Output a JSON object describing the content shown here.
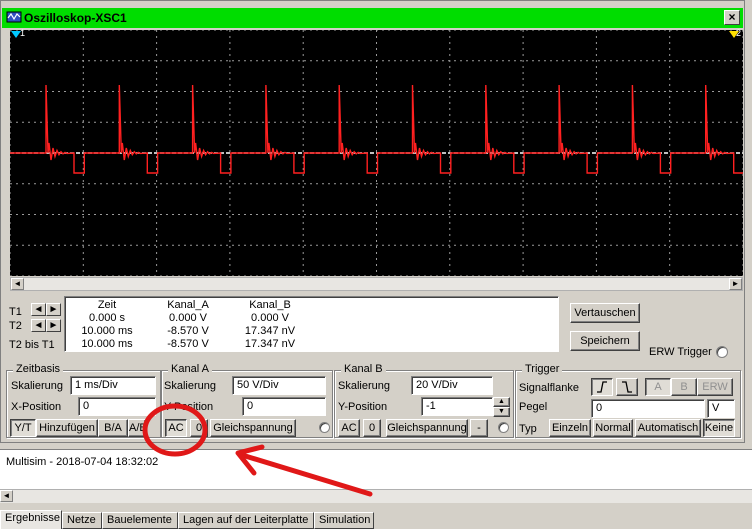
{
  "window": {
    "title": "Oszilloskop-XSC1",
    "close_label": "×"
  },
  "scope": {
    "cursor_1_label": "1",
    "cursor_2_label": "2"
  },
  "cursor_panel": {
    "t1_label": "T1",
    "t2_label": "T2",
    "t2_minus_t1_label": "T2 bis T1",
    "arrow_left": "◄",
    "arrow_right": "►"
  },
  "readout": {
    "headers": [
      "Zeit",
      "Kanal_A",
      "Kanal_B"
    ],
    "rows": [
      [
        "0.000 s",
        "0.000 V",
        "0.000 V"
      ],
      [
        "10.000 ms",
        "-8.570 V",
        "17.347 nV"
      ],
      [
        "10.000 ms",
        "-8.570 V",
        "17.347 nV"
      ]
    ]
  },
  "right_buttons": {
    "swap": "Vertauschen",
    "save": "Speichern",
    "ext_trigger": "ERW Trigger"
  },
  "timebase": {
    "title": "Zeitbasis",
    "scale_label": "Skalierung",
    "scale_value": "1 ms/Div",
    "xpos_label": "X-Position",
    "xpos_value": "0",
    "mode_buttons": [
      "Y/T",
      "Hinzufügen",
      "B/A",
      "A/B"
    ]
  },
  "channel_a": {
    "title": "Kanal A",
    "scale_label": "Skalierung",
    "scale_value": "50  V/Div",
    "ypos_label": "Y-Position",
    "ypos_value": "0",
    "coupling_buttons": [
      "AC",
      "0",
      "Gleichspannung"
    ]
  },
  "channel_b": {
    "title": "Kanal B",
    "scale_label": "Skalierung",
    "scale_value": "20  V/Div",
    "ypos_label": "Y-Position",
    "ypos_value": "-1",
    "coupling_buttons": [
      "AC",
      "0",
      "Gleichspannung",
      "-"
    ]
  },
  "trigger": {
    "title": "Trigger",
    "edge_label": "Signalflanke",
    "edge_buttons": [
      "⨍",
      "⨍"
    ],
    "source_buttons": [
      "A",
      "B",
      "ERW"
    ],
    "level_label": "Pegel",
    "level_value": "0",
    "level_unit": "V",
    "type_label": "Typ",
    "type_buttons": [
      "Einzeln",
      "Normal",
      "Automatisch",
      "Keine"
    ]
  },
  "status": {
    "message": "Multisim  -  2018-07-04 18:32:02"
  },
  "bottom_tabs": [
    "Ergebnisse",
    "Netze",
    "Bauelemente",
    "Lagen auf der Leiterplatte",
    "Simulation"
  ],
  "colors": {
    "title_bar": "#00dd00",
    "trace_a": "#ff2020",
    "trace_b": "#ffffff",
    "grid": "#9a9a9a",
    "screen_bg": "#000000",
    "annotation": "#e01818"
  }
}
